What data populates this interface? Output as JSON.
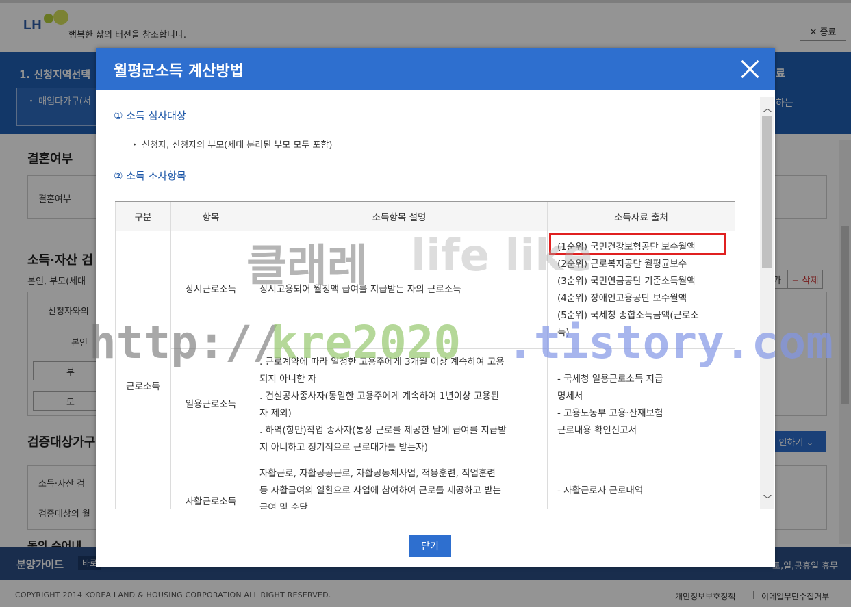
{
  "header": {
    "logo_text": "LH",
    "slogan": "행복한 삶의 터전을 창조합니다.",
    "exit_label": "✕ 종료"
  },
  "steps": {
    "current": "1. 신청지역선택",
    "sub_item": "・ 매입다가구(서",
    "right_label": "료",
    "right_sub": "하는"
  },
  "background": {
    "marriage_heading": "결혼여부",
    "marriage_label": "결혼여부",
    "income_heading": "소득·자산 검",
    "income_sub": "본인, 부모(세대",
    "col_relation": "신청자와의",
    "self": "본인",
    "father": "부",
    "mother": "모",
    "add_btn": "가",
    "delete_btn": "− 삭제",
    "verify_heading": "검증대상가구",
    "verify_btn": "인하기 ⌄",
    "verify_row1": "소득·자산 검",
    "verify_row2": "검증대상의 월",
    "agree_heading": "동의 수어내"
  },
  "footer": {
    "guide_label": "분양가이드",
    "guide_chip": "바로",
    "guide_right": "토,일,공휴일 휴무",
    "copyright": "COPYRIGHT 2014 KOREA LAND & HOUSING CORPORATION ALL RIGHT RESERVED.",
    "privacy": "개인정보보호정책",
    "no_email": "이메일무단수집거부"
  },
  "modal": {
    "title": "월평균소득 계산방법",
    "section1_title": "① 소득 심사대상",
    "section1_bullet": "・ 신청자, 신청자의 부모(세대 분리된 부모 모두 포함)",
    "section2_title": "② 소득 조사항목",
    "table": {
      "headers": [
        "구분",
        "항목",
        "소득항목 설명",
        "소득자료 출처"
      ],
      "category": "근로소득",
      "rows": [
        {
          "item": "상시근로소득",
          "desc": [
            "상시고용되어 월정액 급여를 지급받는 자의 근로소득"
          ],
          "source": [
            "(1순위) 국민건강보험공단 보수월액",
            "(2순위) 근로복지공단 월평균보수",
            "(3순위) 국민연금공단 기준소득월액",
            "(4순위) 장애인고용공단 보수월액",
            "(5순위) 국세청 종합소득금액(근로소",
            "득)"
          ]
        },
        {
          "item": "일용근로소득",
          "desc": [
            ". 근로계약에 따라 일정한 고용주에게 3개월 이상 계속하여 고용",
            "되지 아니한 자",
            ". 건설공사종사자(동일한 고용주에게 계속하여 1년이상 고용된",
            "자 제외)",
            ". 하역(항만)작업 종사자(통상 근로를 제공한 날에 급여를 지급받",
            "지 아니하고 정기적으로 근로대가를 받는자)"
          ],
          "source": [
            "- 국세청 일용근로소득 지급",
            "명세서",
            "- 고용노동부 고용·산재보험",
            "근로내용 확인신고서"
          ]
        },
        {
          "item": "자활근로소득",
          "desc": [
            "자활근로, 자활공공근로, 자활공동체사업, 적응훈련, 직업훈련",
            "등 자활급여의 일환으로 사업에 참여하여 근로를 제공하고 받는",
            "급여 및 수당"
          ],
          "source": [
            "- 자활근로자 근로내역"
          ]
        }
      ]
    },
    "close_label": "닫기"
  },
  "watermark": {
    "line1_a": "클래레",
    "line1_b": "life like",
    "line2_a": "http://",
    "line2_b": "kre2020",
    "line2_c": ".tistory.com"
  },
  "colors": {
    "modal_header": "#2e6fcf",
    "step_bar": "#1f5fb3",
    "highlight": "#e02020",
    "footer": "#2b4f86"
  }
}
